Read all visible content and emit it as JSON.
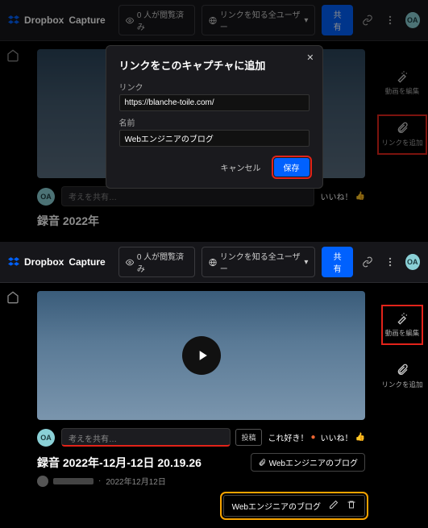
{
  "brand": {
    "name": "Dropbox",
    "product": "Capture"
  },
  "topbar": {
    "views": "0 人が閲覧済み",
    "access": "リンクを知る全ユーザー",
    "share": "共有",
    "avatar": "OA"
  },
  "rightrail": {
    "edit_video": "動画を編集",
    "add_link": "リンクを追加"
  },
  "modal": {
    "title": "リンクをこのキャプチャに追加",
    "link_label": "リンク",
    "link_value": "https://blanche-toile.com/",
    "name_label": "名前",
    "name_value": "Webエンジニアのブログ",
    "cancel": "キャンセル",
    "save": "保存"
  },
  "comment": {
    "placeholder": "考えを共有…",
    "post": "投稿",
    "like": "これ好き！",
    "nice": "いいね！"
  },
  "video": {
    "title_partial": "録音 2022年",
    "title_full": "録音 2022年-12月-12日 20.19.26",
    "date": "2022年12月12日"
  },
  "link_chip": "Webエンジニアのブログ",
  "link_edit": "Webエンジニアのブログ",
  "avatar_small": "OA"
}
